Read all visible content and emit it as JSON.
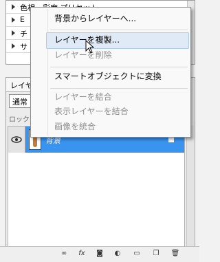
{
  "presets": {
    "items": [
      "色相・彩度 プリセット",
      "E",
      "チ",
      "サ"
    ]
  },
  "panel": {
    "tab": "レイヤ",
    "blend_mode": "通常",
    "lock_label": "ロック",
    "layer": {
      "name": "背景"
    }
  },
  "menu": {
    "items": [
      {
        "label": "背景からレイヤーへ..."
      },
      {
        "label": "レイヤーを複製..."
      },
      {
        "label": "レイヤーを削除"
      },
      {
        "label": "スマートオブジェクトに変換"
      },
      {
        "label": "レイヤーを結合"
      },
      {
        "label": "表示レイヤーを結合"
      },
      {
        "label": "画像を統合"
      }
    ]
  },
  "toolbar": {
    "fx_label": "fx"
  },
  "colors": {
    "selection": "#3994f0",
    "menu_hover": "#dfeaf6"
  }
}
